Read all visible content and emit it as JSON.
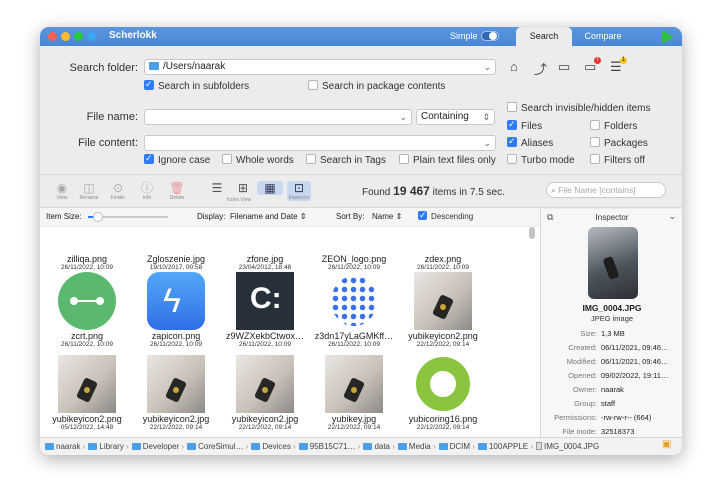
{
  "window": {
    "title": "Scherlokk",
    "mode_label": "Simple",
    "tabs": [
      {
        "label": "Search"
      },
      {
        "label": "Compare"
      }
    ]
  },
  "search": {
    "folder_label": "Search folder:",
    "folder_value": "/Users/naarak",
    "in_subfolders": "Search in subfolders",
    "in_package": "Search in package contents",
    "file_name_label": "File name:",
    "file_name_value": "",
    "containing": "Containing",
    "file_content_label": "File content:",
    "file_content_value": "",
    "ignore_case": "Ignore case",
    "whole_words": "Whole words",
    "in_tags": "Search in Tags",
    "plain_text": "Plain text files only",
    "invisible": "Search invisible/hidden items",
    "files": "Files",
    "folders": "Folders",
    "aliases": "Aliases",
    "packages": "Packages",
    "turbo": "Turbo mode",
    "filters_off": "Filters off"
  },
  "toolbar": {
    "view": "View",
    "rename": "Rename",
    "finder": "Finder",
    "info": "Info",
    "delete": "Delete",
    "icons_view": "Icons View",
    "inspector": "Inspector",
    "found_prefix": "Found",
    "found_count": "19 467",
    "found_suffix": "items in 7.5 sec.",
    "filter_placeholder": "File Name [contains]"
  },
  "options": {
    "item_size_label": "Item Size:",
    "display_label": "Display:",
    "display_value": "Filename and Date",
    "sort_label": "Sort By:",
    "sort_value": "Name",
    "descending": "Descending"
  },
  "files": [
    {
      "name": "zilliqa.png",
      "date": "26/11/2022, 10:09",
      "thumb": "zilliqa"
    },
    {
      "name": "Zgloszenie.jpg",
      "date": "19/10/2017, 00:58",
      "thumb": "JPEG"
    },
    {
      "name": "zfone.jpg",
      "date": "23/04/2012, 18:48",
      "thumb": "dark"
    },
    {
      "name": "ZEON_logo.png",
      "date": "26/11/2022, 10:09",
      "thumb": "star"
    },
    {
      "name": "zdex.png",
      "date": "26/11/2022, 10:09",
      "thumb": "blue"
    },
    {
      "name": "zcrt.png",
      "date": "26/11/2022, 10:09",
      "thumb": "zcrt"
    },
    {
      "name": "zapicon.png",
      "date": "26/11/2022, 10:09",
      "thumb": "zap"
    },
    {
      "name": "z9WZXekbCtwox…",
      "date": "26/11/2022, 10:09",
      "thumb": "c"
    },
    {
      "name": "z3dn17yLaGMKff…",
      "date": "26/11/2022, 10:09",
      "thumb": "dots"
    },
    {
      "name": "yubikeyicon2.png",
      "date": "22/12/2022, 09:14",
      "thumb": "photo"
    },
    {
      "name": "yubikeyicon2.png",
      "date": "05/12/2022, 14:48",
      "thumb": "photo"
    },
    {
      "name": "yubikeyicon2.jpg",
      "date": "22/12/2022, 09:14",
      "thumb": "photo"
    },
    {
      "name": "yubikeyicon2.jpg",
      "date": "22/12/2022, 09:14",
      "thumb": "photo"
    },
    {
      "name": "yubikey.jpg",
      "date": "22/12/2022, 09:14",
      "thumb": "photo"
    },
    {
      "name": "yubicoring16.png",
      "date": "22/12/2022, 09:14",
      "thumb": "ring"
    }
  ],
  "inspector": {
    "title": "Inspector",
    "file_name": "IMG_0004.JPG",
    "file_kind": "JPEG image",
    "rows": [
      {
        "k": "Size:",
        "v": "1,3 MB"
      },
      {
        "k": "Created:",
        "v": "06/11/2021, 09:46…"
      },
      {
        "k": "Modified:",
        "v": "06/11/2021, 09:46…"
      },
      {
        "k": "Opened:",
        "v": "09/02/2022, 19:11…"
      },
      {
        "k": "Owner:",
        "v": "naarak"
      },
      {
        "k": "Group:",
        "v": "staff"
      },
      {
        "k": "Permissions:",
        "v": "-rw-rw-r-- (664)"
      },
      {
        "k": "File inode:",
        "v": "32518373"
      }
    ]
  },
  "path": [
    "naarak",
    "Library",
    "Developer",
    "CoreSimul…",
    "Devices",
    "95B15C71…",
    "data",
    "Media",
    "DCIM",
    "100APPLE",
    "IMG_0004.JPG"
  ],
  "colors": {
    "accent": "#2f7bf5",
    "titlebar": "#4a86d5",
    "play": "#2fc13d"
  }
}
